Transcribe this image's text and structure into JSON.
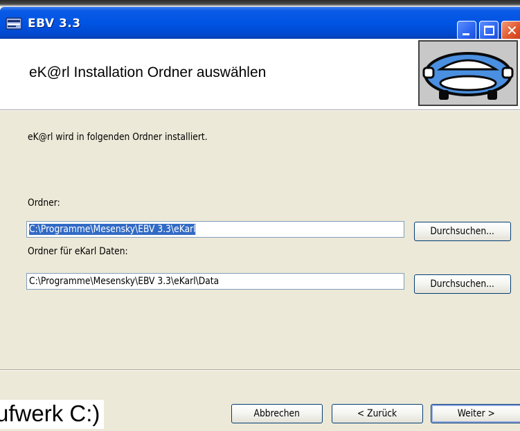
{
  "window": {
    "title": "EBV 3.3",
    "icon": "installer-icon"
  },
  "banner": {
    "title": "eK@rl Installation Ordner auswählen",
    "image": "car-icon"
  },
  "content": {
    "intro": "eK@rl wird in folgenden Ordner installiert.",
    "folder_label": "Ordner:",
    "folder_value": "C:\\Programme\\Mesensky\\EBV 3.3\\eKarl",
    "data_folder_label": "Ordner für eKarl Daten:",
    "data_folder_value": "C:\\Programme\\Mesensky\\EBV 3.3\\eKarl\\Data",
    "browse_label": "Durchsuchen...",
    "browse_data_label": "Durchsuchen..."
  },
  "footer": {
    "cancel_label": "Abbrechen",
    "back_label": "< Zurück",
    "next_label": "Weiter >"
  },
  "overlay": {
    "text": "ufwerk C:)"
  },
  "colors": {
    "titlebar": "#0054e3",
    "dialog_bg": "#ece9d8",
    "selection": "#316ac5",
    "close_button": "#e0552b"
  }
}
